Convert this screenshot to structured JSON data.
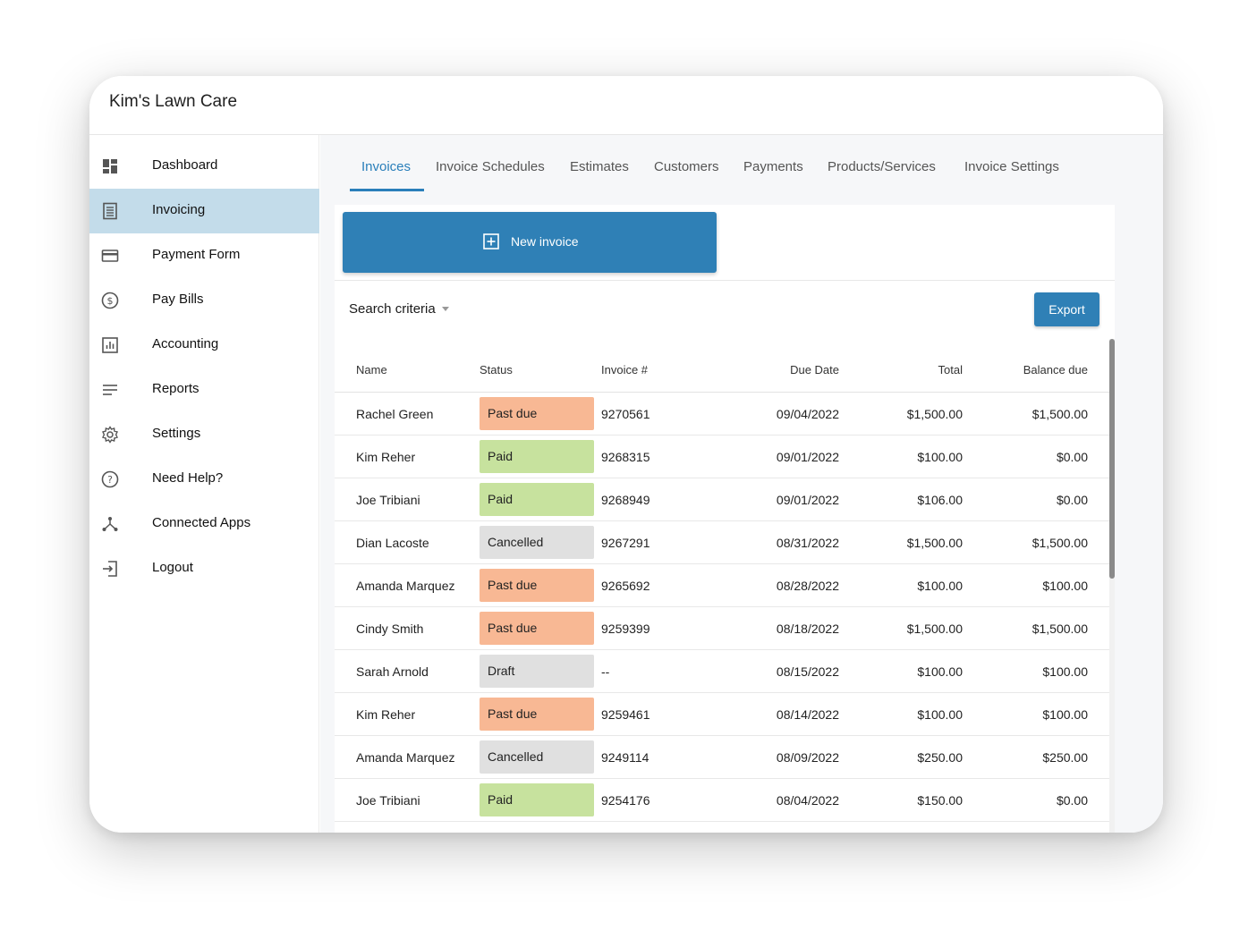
{
  "app": {
    "title": "Kim's Lawn Care"
  },
  "sidebar": {
    "items": [
      {
        "label": "Dashboard",
        "icon": "dashboard-icon"
      },
      {
        "label": "Invoicing",
        "icon": "document-icon",
        "active": true
      },
      {
        "label": "Payment Form",
        "icon": "credit-card-icon"
      },
      {
        "label": "Pay Bills",
        "icon": "dollar-circle-icon"
      },
      {
        "label": "Accounting",
        "icon": "bar-chart-icon"
      },
      {
        "label": "Reports",
        "icon": "lines-icon"
      },
      {
        "label": "Settings",
        "icon": "gear-icon"
      },
      {
        "label": "Need Help?",
        "icon": "help-circle-icon"
      },
      {
        "label": "Connected Apps",
        "icon": "network-icon"
      },
      {
        "label": "Logout",
        "icon": "logout-icon"
      }
    ]
  },
  "tabs": [
    {
      "label": "Invoices",
      "active": true
    },
    {
      "label": "Invoice Schedules"
    },
    {
      "label": "Estimates"
    },
    {
      "label": "Customers"
    },
    {
      "label": "Payments"
    },
    {
      "label": "Products/Services"
    },
    {
      "label": "Invoice Settings"
    }
  ],
  "actions": {
    "new_invoice_label": "New invoice",
    "export_label": "Export"
  },
  "search": {
    "label": "Search criteria"
  },
  "table": {
    "headers": {
      "name": "Name",
      "status": "Status",
      "invoice": "Invoice #",
      "due_date": "Due Date",
      "total": "Total",
      "balance": "Balance due"
    },
    "rows": [
      {
        "name": "Rachel Green",
        "status": "Past due",
        "invoice": "9270561",
        "due_date": "09/04/2022",
        "total": "$1,500.00",
        "balance": "$1,500.00"
      },
      {
        "name": "Kim Reher",
        "status": "Paid",
        "invoice": "9268315",
        "due_date": "09/01/2022",
        "total": "$100.00",
        "balance": "$0.00"
      },
      {
        "name": "Joe Tribiani",
        "status": "Paid",
        "invoice": "9268949",
        "due_date": "09/01/2022",
        "total": "$106.00",
        "balance": "$0.00"
      },
      {
        "name": "Dian Lacoste",
        "status": "Cancelled",
        "invoice": "9267291",
        "due_date": "08/31/2022",
        "total": "$1,500.00",
        "balance": "$1,500.00"
      },
      {
        "name": "Amanda Marquez",
        "status": "Past due",
        "invoice": "9265692",
        "due_date": "08/28/2022",
        "total": "$100.00",
        "balance": "$100.00"
      },
      {
        "name": "Cindy Smith",
        "status": "Past due",
        "invoice": "9259399",
        "due_date": "08/18/2022",
        "total": "$1,500.00",
        "balance": "$1,500.00"
      },
      {
        "name": "Sarah Arnold",
        "status": "Draft",
        "invoice": "--",
        "due_date": "08/15/2022",
        "total": "$100.00",
        "balance": "$100.00"
      },
      {
        "name": "Kim Reher",
        "status": "Past due",
        "invoice": "9259461",
        "due_date": "08/14/2022",
        "total": "$100.00",
        "balance": "$100.00"
      },
      {
        "name": "Amanda Marquez",
        "status": "Cancelled",
        "invoice": "9249114",
        "due_date": "08/09/2022",
        "total": "$250.00",
        "balance": "$250.00"
      },
      {
        "name": "Joe Tribiani",
        "status": "Paid",
        "invoice": "9254176",
        "due_date": "08/04/2022",
        "total": "$150.00",
        "balance": "$0.00"
      }
    ]
  },
  "colors": {
    "accent": "#2f80b6",
    "active_nav": "#c3dcea",
    "past_due": "#f8b894",
    "paid": "#c7e29e",
    "neutral": "#e0e0e0"
  }
}
